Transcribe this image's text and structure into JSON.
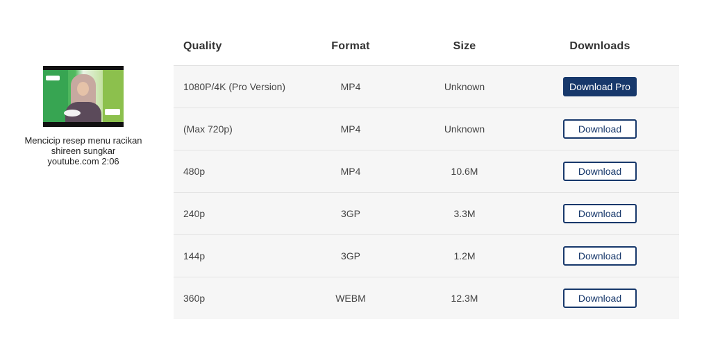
{
  "video": {
    "title_line1": "Mencicip resep menu racikan",
    "title_line2": "shireen sungkar",
    "source_duration": "youtube.com 2:06"
  },
  "table": {
    "headers": {
      "quality": "Quality",
      "format": "Format",
      "size": "Size",
      "downloads": "Downloads"
    },
    "rows": [
      {
        "quality": "1080P/4K (Pro Version)",
        "format": "MP4",
        "size": "Unknown",
        "button": "Download Pro"
      },
      {
        "quality": "(Max 720p)",
        "format": "MP4",
        "size": "Unknown",
        "button": "Download"
      },
      {
        "quality": "480p",
        "format": "MP4",
        "size": "10.6M",
        "button": "Download"
      },
      {
        "quality": "240p",
        "format": "3GP",
        "size": "3.3M",
        "button": "Download"
      },
      {
        "quality": "144p",
        "format": "3GP",
        "size": "1.2M",
        "button": "Download"
      },
      {
        "quality": "360p",
        "format": "WEBM",
        "size": "12.3M",
        "button": "Download"
      }
    ]
  },
  "colors": {
    "button_primary": "#17386b",
    "row_background": "#f6f6f6",
    "thumbnail_green": "#37a552"
  }
}
